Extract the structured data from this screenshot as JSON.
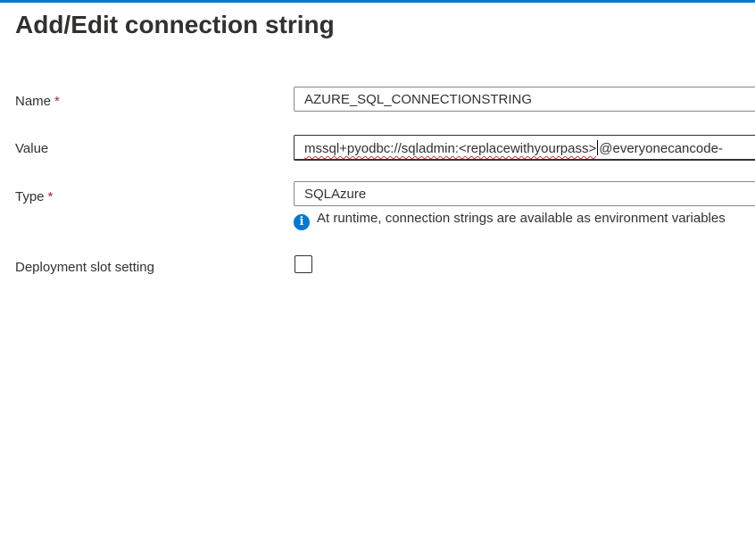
{
  "dialog": {
    "title": "Add/Edit connection string"
  },
  "form": {
    "name": {
      "label": "Name",
      "required_mark": "*",
      "value": "AZURE_SQL_CONNECTIONSTRING"
    },
    "value": {
      "label": "Value",
      "value_before_caret": "mssql+pyodbc://sqladmin:<replacewithyourpass>",
      "value_after_caret": "@everyonecancode-"
    },
    "type": {
      "label": "Type",
      "required_mark": "*",
      "value": "SQLAzure"
    },
    "info": {
      "icon": "info-icon",
      "text": "At runtime, connection strings are available as environment variables"
    },
    "slot_setting": {
      "label": "Deployment slot setting",
      "checked": false
    }
  },
  "colors": {
    "accent": "#0078d4",
    "required": "#a4262c",
    "spellcheck": "#d13438"
  }
}
